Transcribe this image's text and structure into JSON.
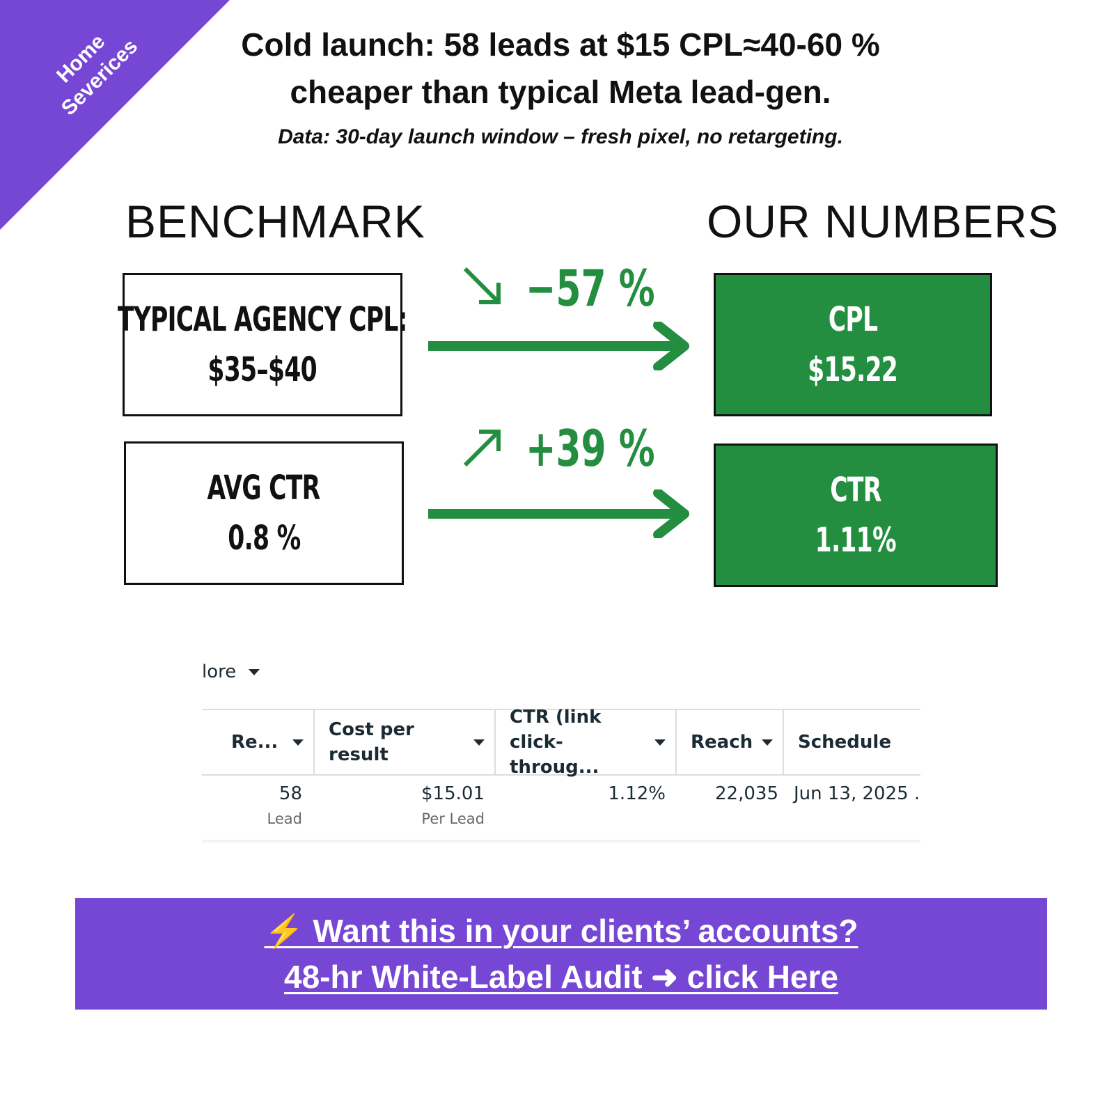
{
  "ribbon": {
    "line1": "Home",
    "line2": "Severices",
    "color": "#7647d4"
  },
  "headline": {
    "line1": "Cold launch: 58 leads at $15 CPL≈40-60 %",
    "line2": "cheaper than typical Meta lead-gen.",
    "subline": "Data: 30-day launch window – fresh pixel, no retargeting."
  },
  "columns": {
    "left": "BENCHMARK",
    "right": "OUR NUMBERS"
  },
  "benchmark": [
    {
      "label": "TYPICAL AGENCY CPL:",
      "value": "$35–$40"
    },
    {
      "label": "AVG CTR",
      "value": "0.8 %"
    }
  ],
  "ours": [
    {
      "label": "CPL",
      "value": "$15.22"
    },
    {
      "label": "CTR",
      "value": "1.11%"
    }
  ],
  "deltas": [
    {
      "text": "−57 %",
      "direction": "down",
      "icon": "arrow-down-right-icon"
    },
    {
      "text": "+39 %",
      "direction": "up",
      "icon": "arrow-up-right-icon"
    }
  ],
  "accent_green": "#238e3f",
  "table": {
    "more_label": "lore",
    "headers": [
      "Re...",
      "Cost per result",
      "CTR (link click-throug...",
      "Reach",
      "Schedule"
    ],
    "row": {
      "results": "58",
      "results_sub": "Lead",
      "cost": "$15.01",
      "cost_sub": "Per Lead",
      "ctr": "1.12%",
      "reach": "22,035",
      "schedule": "Jun 13, 2025 ."
    }
  },
  "cta": {
    "bolt": "⚡",
    "line1": " Want this in your clients’ accounts?",
    "line2": "48-hr White-Label Audit ➜ click Here",
    "color": "#7647d4"
  }
}
